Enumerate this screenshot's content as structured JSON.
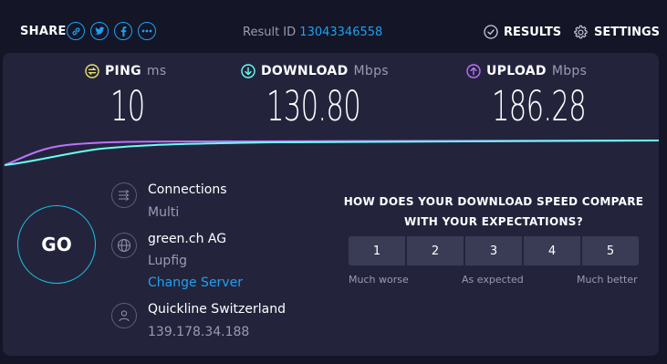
{
  "share": {
    "label": "SHARE",
    "icons": [
      "link-icon",
      "twitter-icon",
      "facebook-icon",
      "more-icon"
    ]
  },
  "result": {
    "label": "Result ID",
    "id": "13043346558"
  },
  "nav": {
    "results": "RESULTS",
    "settings": "SETTINGS"
  },
  "metrics": {
    "ping": {
      "label": "PING",
      "unit": "ms",
      "value": "10",
      "color": "#e8e36a"
    },
    "download": {
      "label": "DOWNLOAD",
      "unit": "Mbps",
      "value": "130.80",
      "color": "#6afff3"
    },
    "upload": {
      "label": "UPLOAD",
      "unit": "Mbps",
      "value": "186.28",
      "color": "#bf71ff"
    }
  },
  "go": "GO",
  "connections": {
    "title": "Connections",
    "value": "Multi"
  },
  "server": {
    "name": "green.ch AG",
    "location": "Lupfig",
    "change": "Change Server"
  },
  "isp": {
    "name": "Quickline Switzerland",
    "ip": "139.178.34.188"
  },
  "survey": {
    "question": "HOW DOES YOUR DOWNLOAD SPEED COMPARE WITH YOUR EXPECTATIONS?",
    "options": [
      "1",
      "2",
      "3",
      "4",
      "5"
    ],
    "low": "Much worse",
    "mid": "As expected",
    "high": "Much better"
  },
  "colors": {
    "accent": "#1da1f2",
    "panel": "#23243c",
    "background": "#141526"
  }
}
